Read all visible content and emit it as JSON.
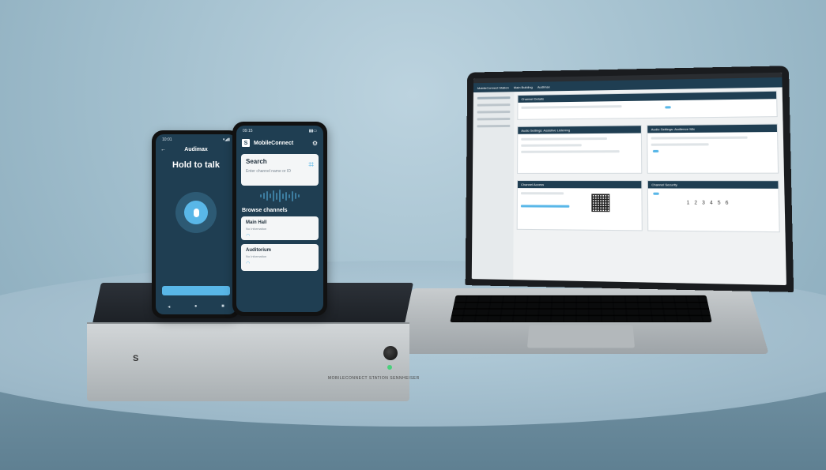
{
  "phone_audimax": {
    "status_time": "10:01",
    "nav_title": "Audimax",
    "hold_to_talk": "Hold to talk",
    "bottom_icons": [
      "◂",
      "●",
      "■"
    ]
  },
  "phone_mobileconnect": {
    "status_time": "09:15",
    "app_title": "MobileConnect",
    "search_title": "Search",
    "search_placeholder": "Enter channel name or ID",
    "browse_title": "Browse channels",
    "channels": [
      {
        "name": "Main Hall",
        "sub": "No Information"
      },
      {
        "name": "Auditorium",
        "sub": "No Information"
      }
    ]
  },
  "base_station": {
    "brand_logo": "S",
    "label": "MOBILECONNECT STATION  SENNHEISER"
  },
  "laptop_app": {
    "top_bar": [
      "MobileConnect Station",
      "Main Building",
      "Audimax"
    ],
    "panels": {
      "details": "Channel Details",
      "listening": "Audio Settings: Assistive Listening",
      "mix": "Audio Settings: Audience Mix",
      "access": "Channel Access",
      "security": "Channel Security"
    },
    "pin_digits": "1 2 3 4 5 6"
  },
  "colors": {
    "app_navy": "#1f3e52",
    "accent_blue": "#59b7e8",
    "background": "#9ebccb"
  }
}
